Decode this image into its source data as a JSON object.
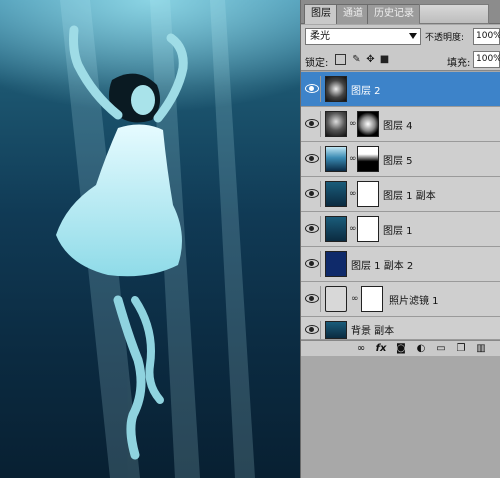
{
  "panel": {
    "tabs": [
      {
        "label": "图层",
        "active": true
      },
      {
        "label": "通道",
        "active": false
      },
      {
        "label": "历史记录",
        "active": false
      }
    ],
    "blend_mode": "柔光",
    "opacity_label": "不透明度:",
    "opacity_value": "100%",
    "lock_label": "锁定:",
    "fill_label": "填充:",
    "fill_value": "100%",
    "layers": [
      {
        "name": "图层 2",
        "selected": true
      },
      {
        "name": "图层 4",
        "selected": false
      },
      {
        "name": "图层 5",
        "selected": false
      },
      {
        "name": "图层 1 副本",
        "selected": false
      },
      {
        "name": "图层 1",
        "selected": false
      },
      {
        "name": "图层 1 副本 2",
        "selected": false
      },
      {
        "name": "照片滤镜 1",
        "selected": false
      },
      {
        "name": "背景 副本",
        "selected": false
      }
    ],
    "bottom_icons": [
      "link-icon",
      "fx-icon",
      "mask-icon",
      "adjustment-icon",
      "folder-icon",
      "new-layer-icon",
      "trash-icon"
    ]
  },
  "colors": {
    "selection": "#3d83c9",
    "panel_bg": "#c9c9c9",
    "water_top": "#3d8aa9",
    "water_bottom": "#082032"
  }
}
